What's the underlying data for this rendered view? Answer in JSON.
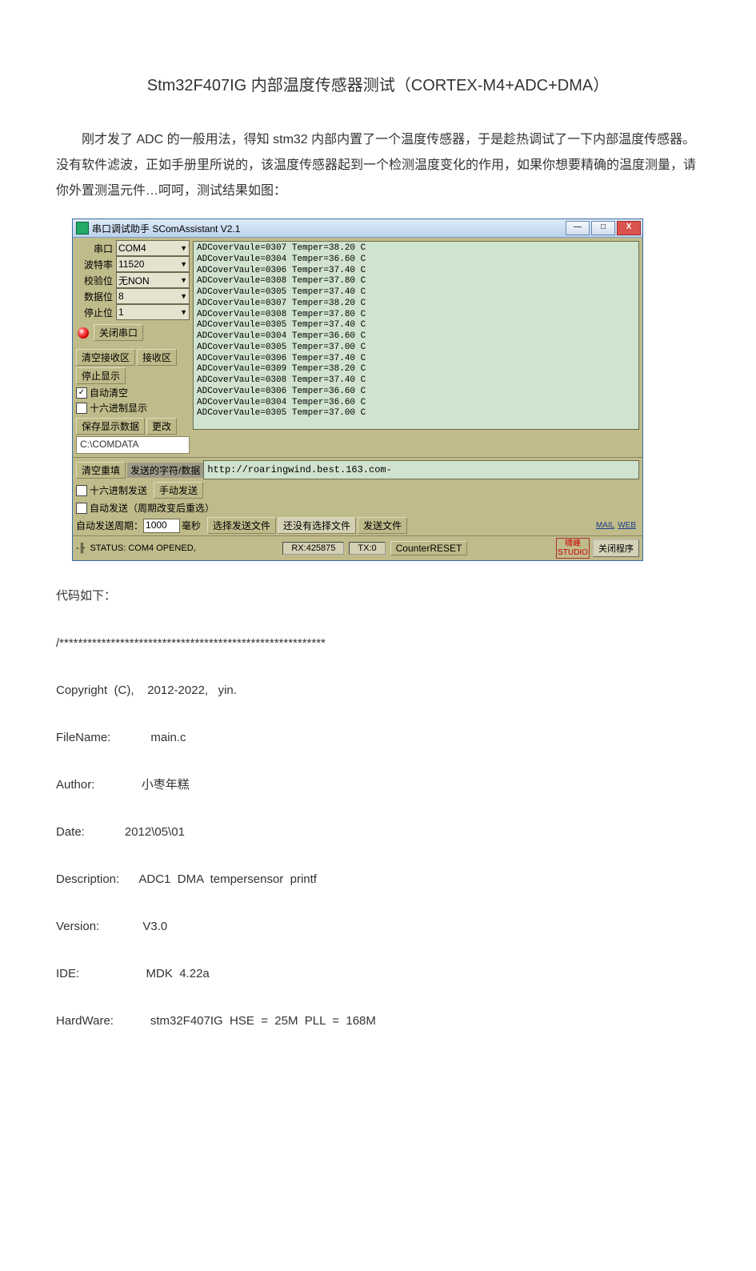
{
  "title": "Stm32F407IG 内部温度传感器测试（CORTEX-M4+ADC+DMA）",
  "intro": "刚才发了 ADC 的一般用法，得知 stm32 内部内置了一个温度传感器，于是趁热调试了一下内部温度传感器。没有软件滤波，正如手册里所说的，该温度传感器起到一个检测温度变化的作用，如果你想要精确的温度测量，请你外置测温元件…呵呵，测试结果如图：",
  "win": {
    "title": "串口调试助手 SComAssistant V2.1",
    "min": "—",
    "max": "□",
    "close": "X",
    "cfg": {
      "port_l": "串口",
      "port_v": "COM4",
      "baud_l": "波特率",
      "baud_v": "11520",
      "parity_l": "校验位",
      "parity_v": "无NON",
      "data_l": "数据位",
      "data_v": "8",
      "stop_l": "停止位",
      "stop_v": "1"
    },
    "close_port": "关闭串口",
    "clear_rx": "清空接收区",
    "rx_area": "接收区",
    "stop_disp": "停止显示",
    "auto_clear": "自动清空",
    "hex_disp": "十六进制显示",
    "save_disp": "保存显示数据",
    "change": "更改",
    "path": "C:\\COMDATA",
    "rx_lines": "ADCoverVaule=0307 Temper=38.20 C\nADCoverVaule=0304 Temper=36.60 C\nADCoverVaule=0306 Temper=37.40 C\nADCoverVaule=0308 Temper=37.80 C\nADCoverVaule=0305 Temper=37.40 C\nADCoverVaule=0307 Temper=38.20 C\nADCoverVaule=0308 Temper=37.80 C\nADCoverVaule=0305 Temper=37.40 C\nADCoverVaule=0304 Temper=36.60 C\nADCoverVaule=0305 Temper=37.00 C\nADCoverVaule=0306 Temper=37.40 C\nADCoverVaule=0309 Temper=38.20 C\nADCoverVaule=0308 Temper=37.40 C\nADCoverVaule=0306 Temper=36.60 C\nADCoverVaule=0304 Temper=36.60 C\nADCoverVaule=0305 Temper=37.00 C",
    "clear_send": "清空重填",
    "send_label": "发送的字符/数据",
    "send_value": "http://roaringwind.best.163.com-",
    "hex_send": "十六进制发送",
    "manual_send": "手动发送",
    "auto_send": "自动发送（周期改变后重选）",
    "period_label": "自动发送周期：",
    "period_value": "1000",
    "period_unit": "毫秒",
    "sel_file": "选择发送文件",
    "no_file": "还没有选择文件",
    "send_file": "发送文件",
    "mail": "MAIL",
    "web": "WEB",
    "studio1": "啸峰",
    "studio2": "STUDIO",
    "close_prog": "关闭程序",
    "status_l": "STATUS: COM4 OPENED,",
    "rx_count": "RX:425875",
    "tx_count": "TX:0",
    "counter_reset": "CounterRESET"
  },
  "code_label": "代码如下：",
  "code": {
    "sep": "/*********************************************************",
    "copyright": "Copyright  (C),    2012-2022,   yin.",
    "filename_l": "FileName:",
    "filename_v": "main.c",
    "author_l": "Author:",
    "author_v": "小枣年糕",
    "date_l": "Date:",
    "date_v": "2012\\05\\01",
    "desc_l": "Description:",
    "desc_v": "ADC1  DMA  tempersensor  printf",
    "ver_l": "Version:",
    "ver_v": "V3.0",
    "ide_l": "IDE:",
    "ide_v": "MDK  4.22a",
    "hw_l": "HardWare:",
    "hw_v": "stm32F407IG  HSE  =  25M  PLL  =  168M"
  }
}
